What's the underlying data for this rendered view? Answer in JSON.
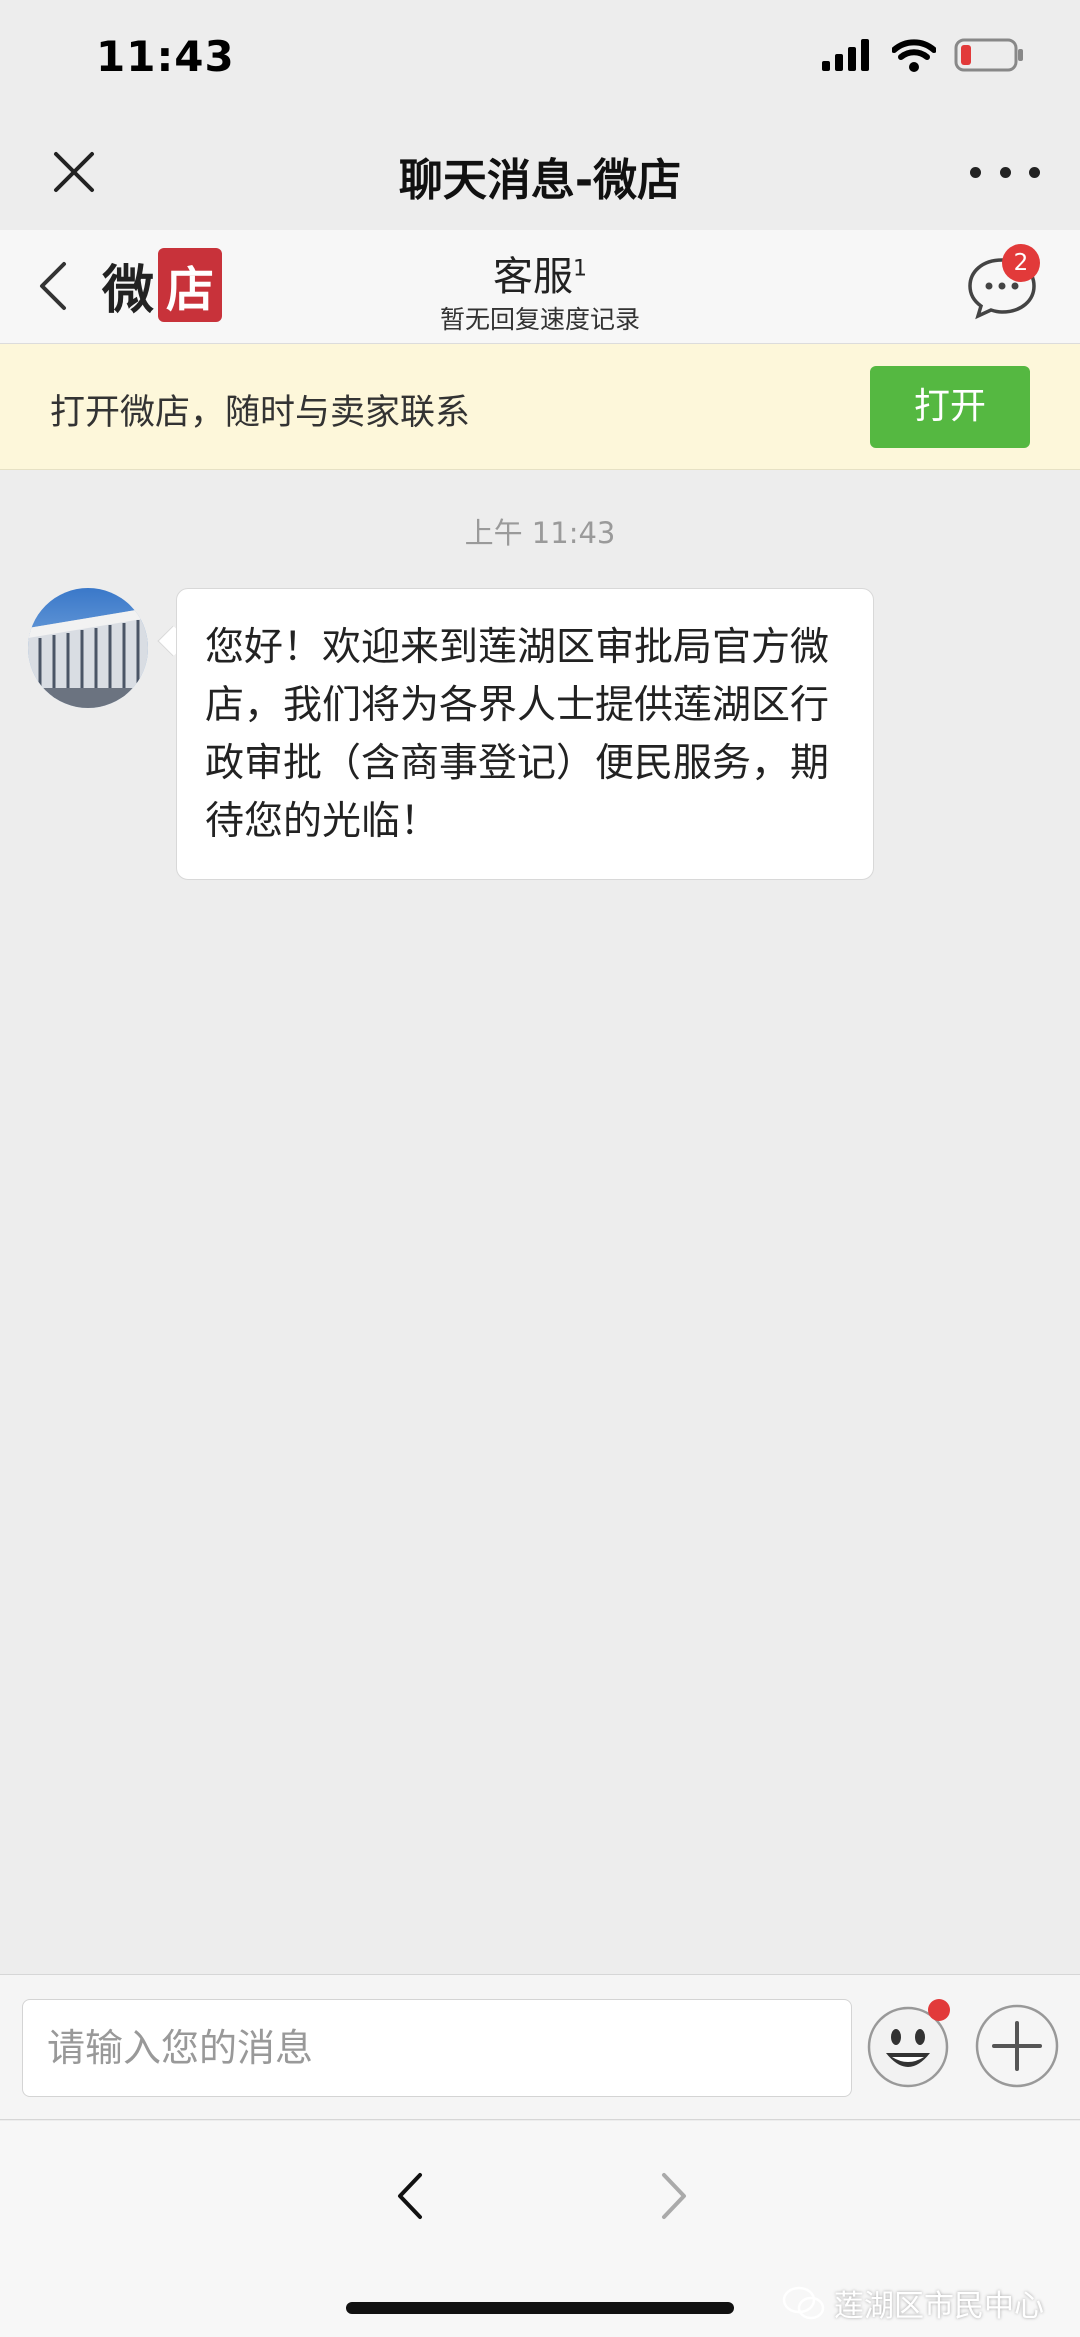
{
  "status_bar": {
    "time": "11:43"
  },
  "title_bar": {
    "title": "聊天消息-微店"
  },
  "shop_header": {
    "logo_text_1": "微",
    "logo_text_2": "店",
    "title": "客服",
    "title_sup": "1",
    "subtitle": "暂无回复速度记录",
    "badge_count": "2"
  },
  "banner": {
    "text": "打开微店，随时与卖家联系",
    "button_label": "打开",
    "button_color": "#55b841"
  },
  "chat": {
    "timestamp": "上午 11:43",
    "messages": [
      {
        "sender": "shop",
        "text": "您好！欢迎来到莲湖区审批局官方微店，我们将为各界人士提供莲湖区行政审批（含商事登记）便民服务，期待您的光临！"
      }
    ]
  },
  "input_bar": {
    "placeholder": "请输入您的消息"
  },
  "watermark": {
    "text": "莲湖区市民中心"
  },
  "colors": {
    "badge": "#e23a3a",
    "logo_red": "#c8323a",
    "banner_bg": "#fdf7da"
  }
}
